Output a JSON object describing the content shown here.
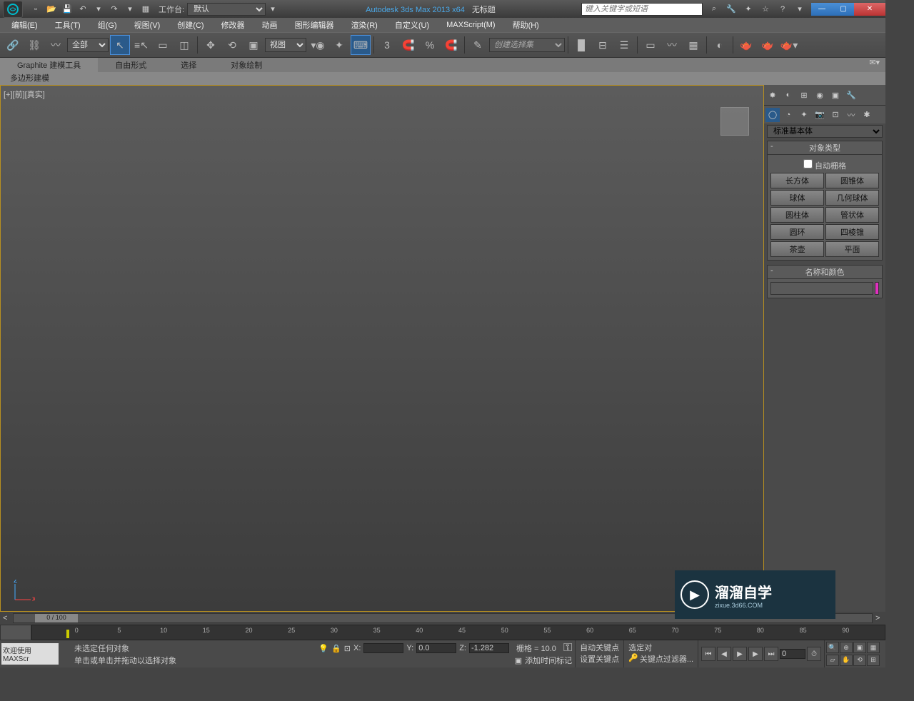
{
  "title": {
    "app": "Autodesk 3ds Max  2013 x64",
    "doc": "无标题",
    "workspace_label": "工作台:",
    "workspace_value": "默认",
    "search_placeholder": "键入关键字或短语"
  },
  "menu": [
    "编辑(E)",
    "工具(T)",
    "组(G)",
    "视图(V)",
    "创建(C)",
    "修改器",
    "动画",
    "图形编辑器",
    "渲染(R)",
    "自定义(U)",
    "MAXScript(M)",
    "帮助(H)"
  ],
  "toolbar": {
    "filter_all": "全部",
    "coord_sys": "视图",
    "selset_placeholder": "创建选择集"
  },
  "ribbon": {
    "tabs": [
      "Graphite 建模工具",
      "自由形式",
      "选择",
      "对象绘制"
    ],
    "sub": "多边形建模"
  },
  "viewport": {
    "label": "[+][前][真实]"
  },
  "panel": {
    "category": "标准基本体",
    "roll_objtype": "对象类型",
    "autogrid": "自动栅格",
    "buttons": [
      [
        "长方体",
        "圆锥体"
      ],
      [
        "球体",
        "几何球体"
      ],
      [
        "圆柱体",
        "管状体"
      ],
      [
        "圆环",
        "四棱锥"
      ],
      [
        "茶壶",
        "平面"
      ]
    ],
    "roll_name": "名称和颜色"
  },
  "timeline": {
    "slider": "0 / 100",
    "ticks": [
      0,
      5,
      10,
      15,
      20,
      25,
      30,
      35,
      40,
      45,
      50,
      55,
      60,
      65,
      70,
      75,
      80,
      85,
      90
    ]
  },
  "status": {
    "script": "欢迎使用  MAXScr",
    "line1": "未选定任何对象",
    "line2": "单击或单击并拖动以选择对象",
    "x": "",
    "y": "0.0",
    "z": "-1.282",
    "grid": "栅格 = 10.0",
    "add_marker": "添加时间标记",
    "auto_key": "自动关键点",
    "set_key": "设置关键点",
    "sel_filter": "选定对",
    "key_filter": "关键点过滤器...",
    "frame": "0"
  },
  "watermark": {
    "big": "溜溜自学",
    "small": "zixue.3d66.COM"
  }
}
